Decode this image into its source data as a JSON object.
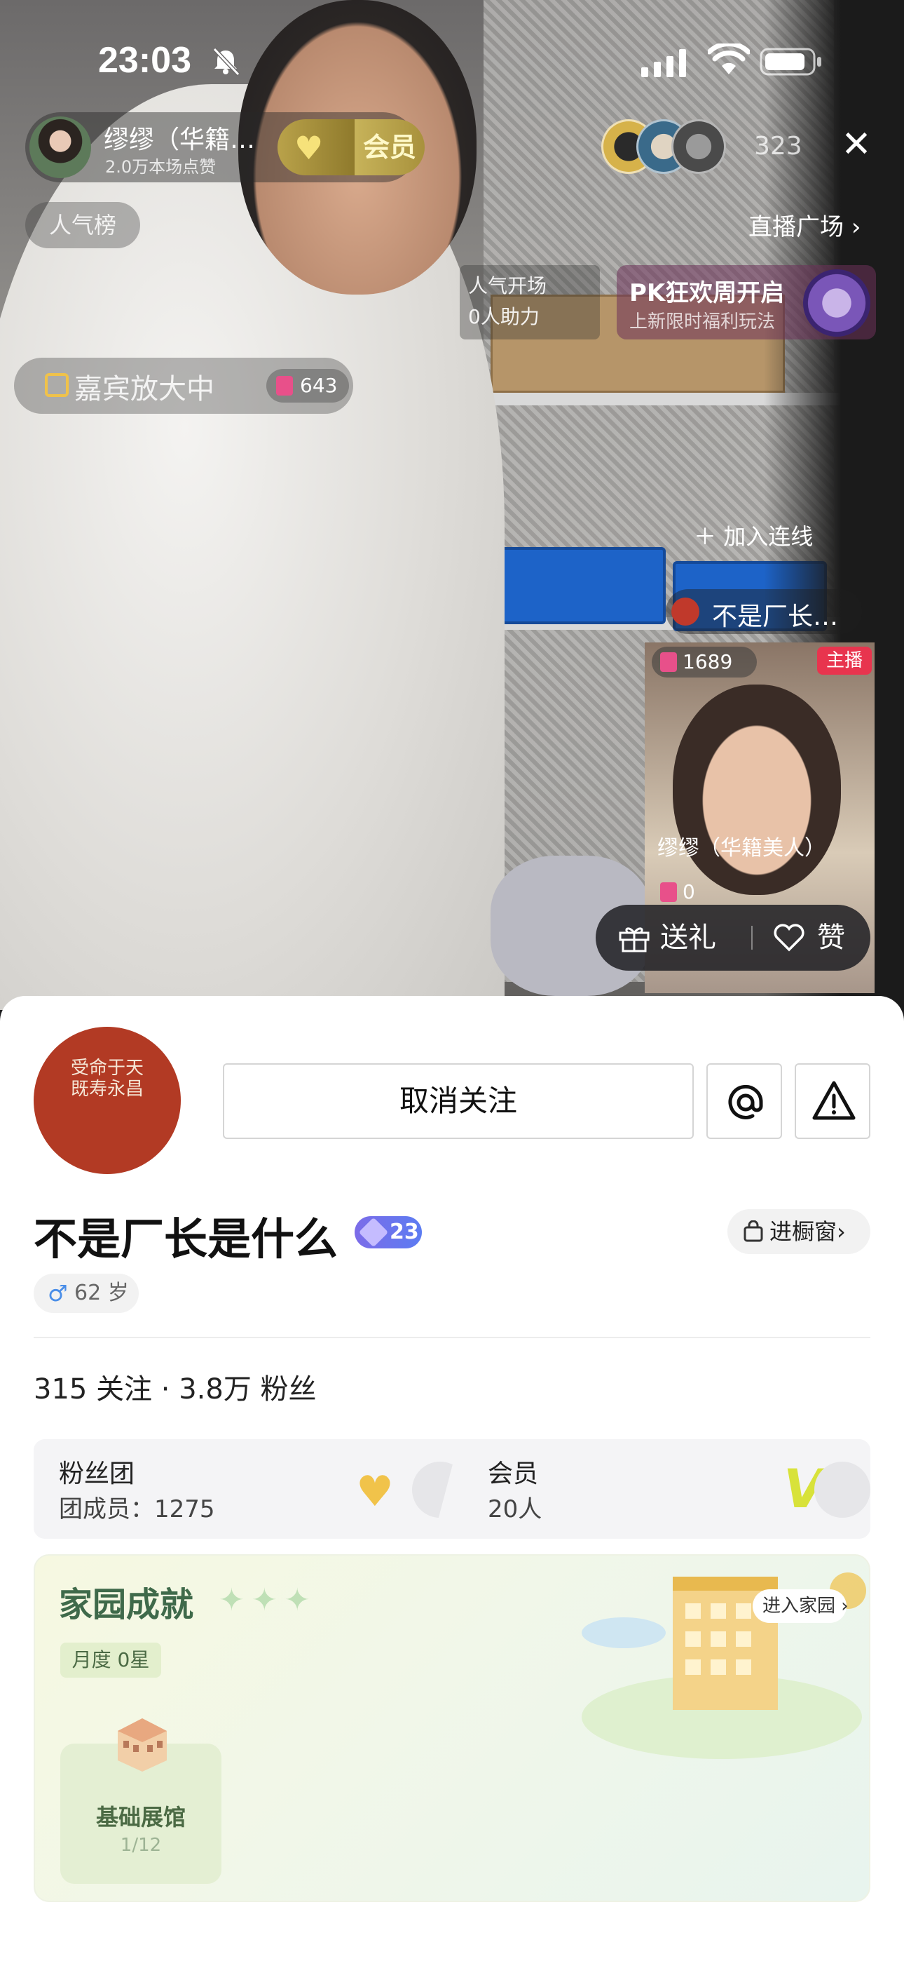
{
  "status_bar": {
    "time": "23:03"
  },
  "live": {
    "host_name": "缪缪（华籍…",
    "host_likes": "2.0万本场点赞",
    "member_label": "会员",
    "viewer_count": "323",
    "rank_label": "人气榜",
    "square_label": "直播广场",
    "popularity_line1": "人气开场",
    "popularity_line2": "0人助力",
    "pk_title": "PK狂欢周开启",
    "pk_sub": "上新限时福利玩法",
    "guest_label": "嘉宾放大中",
    "guest_gift_count": "643",
    "join_label": "加入连线",
    "guest_name": "不是厂长…",
    "cohost_gift_count": "1689",
    "cohost_tag": "主播",
    "cohost_name": "缪缪（华籍美人）",
    "cohost_zero": "0",
    "gift_label": "送礼",
    "like_label": "赞"
  },
  "profile": {
    "avatar_seal": [
      "受命于天",
      "既寿永昌"
    ],
    "unfollow_label": "取消关注",
    "at_label": "@",
    "name": "不是厂长是什么",
    "level": "23",
    "shop_label": "进橱窗",
    "age": "62 岁",
    "follow_stats": "315 关注 · 3.8万 粉丝",
    "fanclub_title": "粉丝团",
    "fanclub_sub": "团成员：1275",
    "member_title": "会员",
    "member_sub": "20人",
    "home_title": "家园成就",
    "home_month": "月度 0星",
    "enter_home": "进入家园",
    "tile_name": "基础展馆",
    "tile_count": "1/12"
  },
  "colors": {
    "accent_red": "#e8344e",
    "avatar_red": "#b23a24",
    "home_green": "#3f6a4a"
  }
}
